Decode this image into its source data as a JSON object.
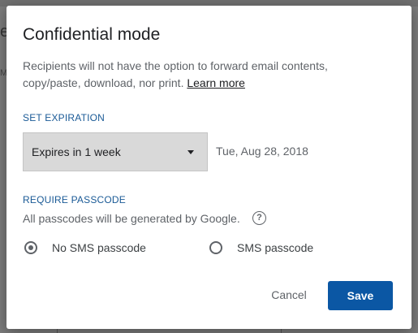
{
  "dialog": {
    "title": "Confidential mode",
    "description": "Recipients will not have the option to forward email contents, copy/paste, download, nor print.",
    "learn_more": "Learn more"
  },
  "expiration": {
    "label": "SET EXPIRATION",
    "selected": "Expires in 1 week",
    "date": "Tue, Aug 28, 2018"
  },
  "passcode": {
    "label": "REQUIRE PASSCODE",
    "info": "All passcodes will be generated by Google.",
    "help_icon": "?",
    "options": [
      {
        "label": "No SMS passcode",
        "checked": true
      },
      {
        "label": "SMS passcode",
        "checked": false
      }
    ]
  },
  "buttons": {
    "cancel": "Cancel",
    "save": "Save"
  },
  "backdrop": {
    "peek_top": "e",
    "peek_side": "M"
  },
  "colors": {
    "accent": "#0b57a4",
    "section_label": "#1a5a96",
    "backdrop": "#7b7b7b"
  }
}
